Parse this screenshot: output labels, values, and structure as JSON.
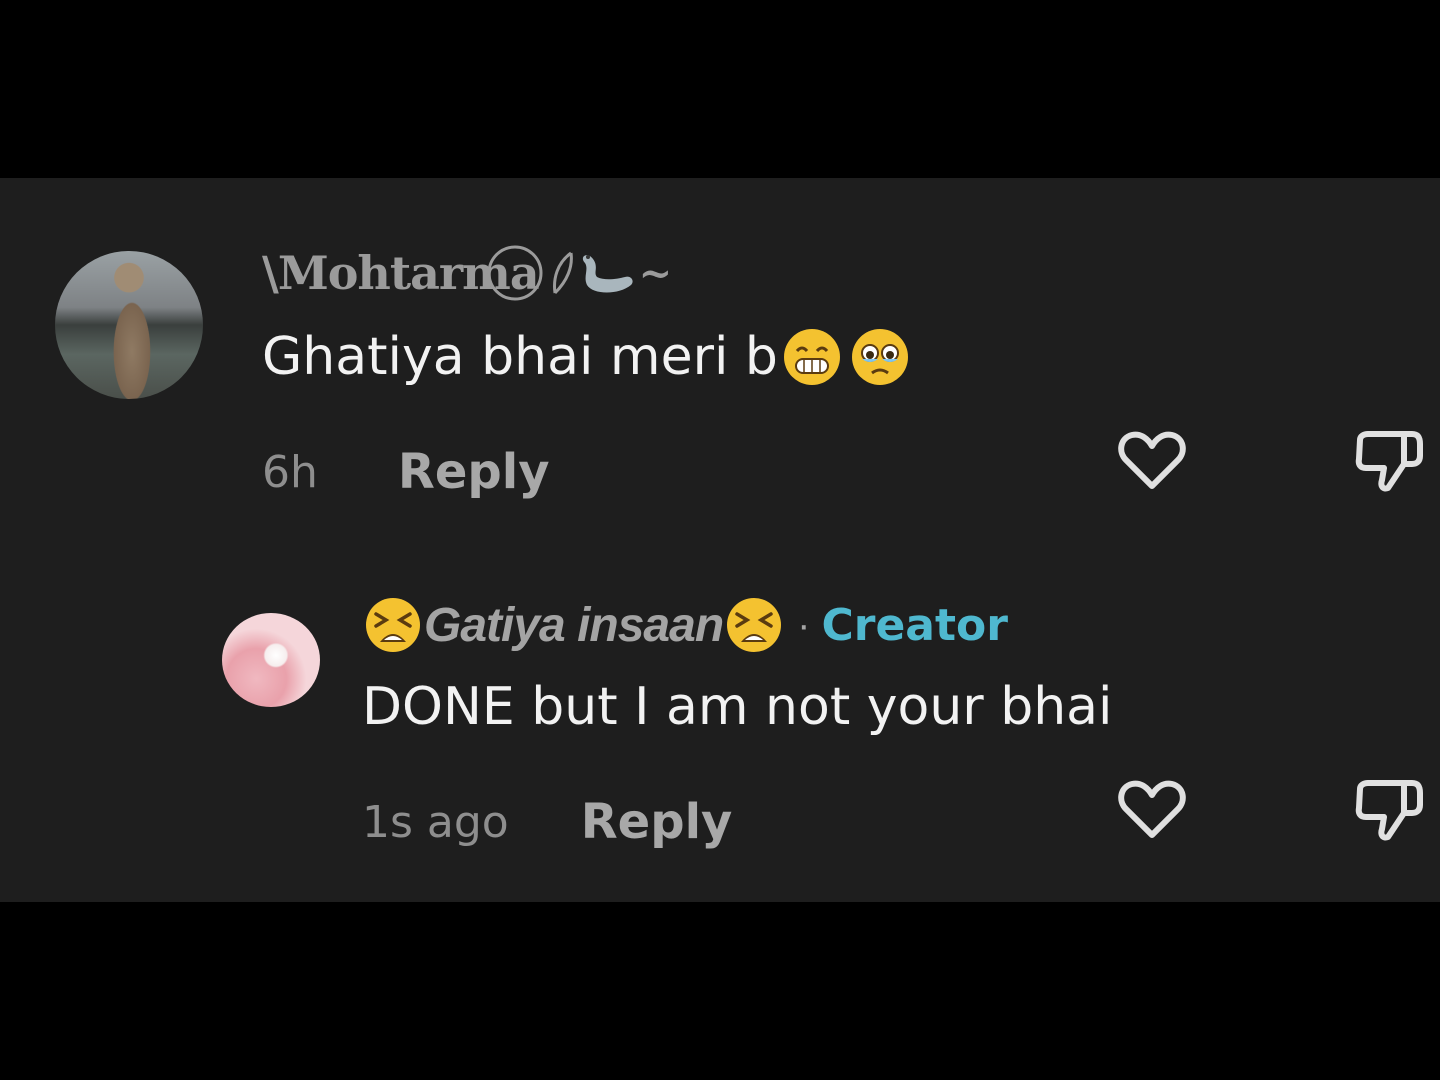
{
  "comments": [
    {
      "username": "Mohtarma",
      "username_prefix": "\\",
      "username_suffix": "~",
      "text": "Ghatiya bhai meri b",
      "emojis": [
        "grinning-face-icon",
        "face-holding-back-tears-icon"
      ],
      "time": "6h",
      "reply_label": "Reply"
    },
    {
      "username": "Gatiya insaan",
      "badge_separator": "·",
      "badge": "Creator",
      "text": "DONE but I am not your bhai",
      "time": "1s ago",
      "reply_label": "Reply"
    }
  ],
  "colors": {
    "background": "#000000",
    "panel": "#1e1e1e",
    "text": "#f2f2f2",
    "muted": "#8e8e8e",
    "creator": "#4fb8cf",
    "emoji_yellow": "#f4c230"
  }
}
